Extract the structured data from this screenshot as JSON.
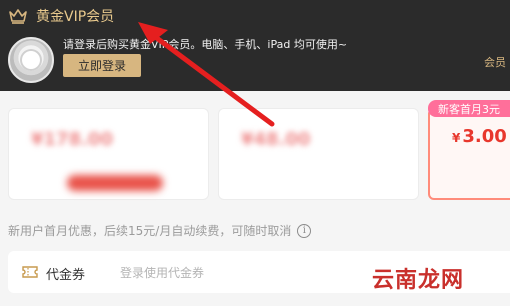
{
  "header": {
    "title": "黄金VIP会员",
    "login_tip": "请登录后购买黄金VIP会员。电脑、手机、iPad 均可使用~",
    "login_button": "立即登录",
    "member_right": "会员"
  },
  "cards": [
    {
      "price": "¥178.00",
      "subtitle": "",
      "blurred": true
    },
    {
      "price": "¥48.00",
      "subtitle": "",
      "blurred": true
    },
    {
      "tag": "新客首月3元",
      "currency": "¥",
      "price": "3.00"
    }
  ],
  "notice": {
    "text": "新用户首月优惠，后续15元/月自动续费，可随时取消",
    "info_icon": "info-icon"
  },
  "coupon": {
    "label": "代金券",
    "placeholder": "登录使用代金券",
    "icon": "ticket-icon"
  },
  "watermark": "云南龙网",
  "colors": {
    "header_bg": "#2b2b2b",
    "gold": "#d7b680",
    "accent_red": "#e8372c",
    "tag_pink": "#ff6f9a",
    "arrow_red": "#e51f1f"
  }
}
